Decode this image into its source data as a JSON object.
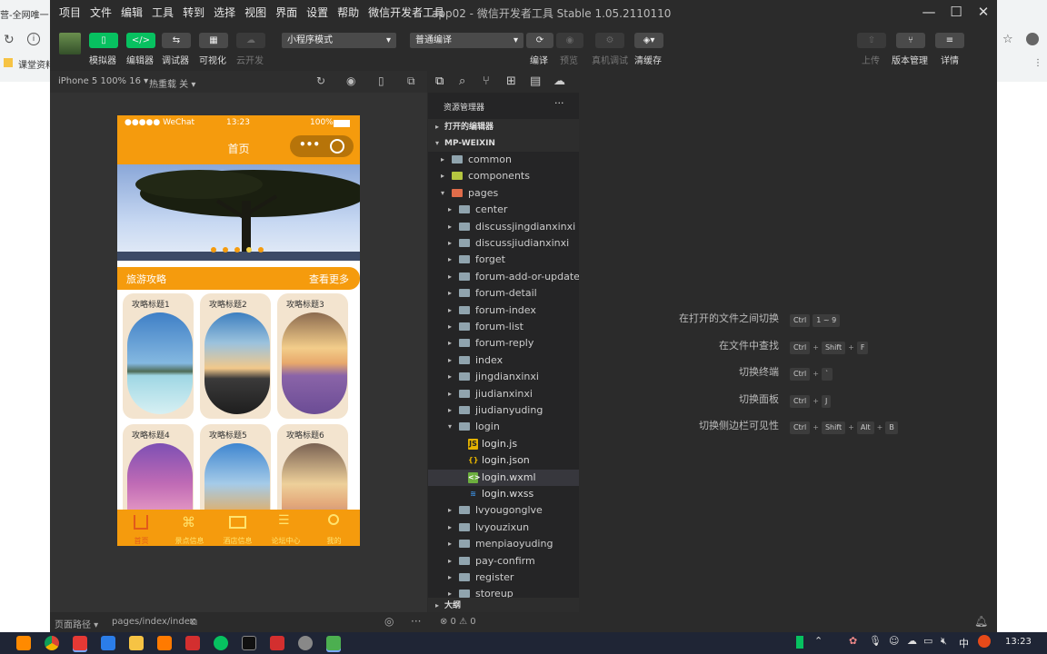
{
  "background_browser": {
    "left_tab_text": "营-全网唯一",
    "bookmark_text": "课堂资料"
  },
  "menubar": {
    "items": [
      "项目",
      "文件",
      "编辑",
      "工具",
      "转到",
      "选择",
      "视图",
      "界面",
      "设置",
      "帮助",
      "微信开发者工具"
    ],
    "window_title": "app02 - 微信开发者工具 Stable 1.05.2110110"
  },
  "toolbar": {
    "simulator_label": "模拟器",
    "editor_label": "编辑器",
    "debugger_label": "调试器",
    "visual_label": "可视化",
    "cloud_label": "云开发",
    "mode_select": "小程序模式",
    "compile_select": "普通编译",
    "compile_label": "编译",
    "preview_label": "预览",
    "remote_debug_label": "真机调试",
    "clear_cache_label": "清缓存",
    "upload_label": "上传",
    "version_label": "版本管理",
    "details_label": "详情"
  },
  "simulator": {
    "device": "iPhone 5 100% 16",
    "hot_reload": "热重载 关",
    "status_carrier": "●●●●● WeChat",
    "status_time": "13:23",
    "status_battery": "100%",
    "nav_title": "首页",
    "section_title": "旅游攻略",
    "section_more": "查看更多",
    "cards": [
      {
        "title": "攻略标题1"
      },
      {
        "title": "攻略标题2"
      },
      {
        "title": "攻略标题3"
      },
      {
        "title": "攻略标题4"
      },
      {
        "title": "攻略标题5"
      },
      {
        "title": "攻略标题6"
      }
    ],
    "tabs": [
      "首页",
      "景点信息",
      "酒店信息",
      "论坛中心",
      "我的"
    ]
  },
  "explorer": {
    "title": "资源管理器",
    "open_editors": "打开的编辑器",
    "project": "MP-WEIXIN",
    "outline": "大纲",
    "tree": [
      {
        "name": "common",
        "type": "folder",
        "depth": 1
      },
      {
        "name": "components",
        "type": "folder",
        "depth": 1
      },
      {
        "name": "pages",
        "type": "folder",
        "depth": 1,
        "open": true
      },
      {
        "name": "center",
        "type": "folder",
        "depth": 2
      },
      {
        "name": "discussjingdianxinxi",
        "type": "folder",
        "depth": 2
      },
      {
        "name": "discussjiudianxinxi",
        "type": "folder",
        "depth": 2
      },
      {
        "name": "forget",
        "type": "folder",
        "depth": 2
      },
      {
        "name": "forum-add-or-update",
        "type": "folder",
        "depth": 2
      },
      {
        "name": "forum-detail",
        "type": "folder",
        "depth": 2
      },
      {
        "name": "forum-index",
        "type": "folder",
        "depth": 2
      },
      {
        "name": "forum-list",
        "type": "folder",
        "depth": 2
      },
      {
        "name": "forum-reply",
        "type": "folder",
        "depth": 2
      },
      {
        "name": "index",
        "type": "folder",
        "depth": 2
      },
      {
        "name": "jingdianxinxi",
        "type": "folder",
        "depth": 2
      },
      {
        "name": "jiudianxinxi",
        "type": "folder",
        "depth": 2
      },
      {
        "name": "jiudianyuding",
        "type": "folder",
        "depth": 2
      },
      {
        "name": "login",
        "type": "folder",
        "depth": 2,
        "open": true
      },
      {
        "name": "login.js",
        "type": "js",
        "depth": 3
      },
      {
        "name": "login.json",
        "type": "json",
        "depth": 3
      },
      {
        "name": "login.wxml",
        "type": "wxml",
        "depth": 3,
        "selected": true
      },
      {
        "name": "login.wxss",
        "type": "wxss",
        "depth": 3
      },
      {
        "name": "lvyougonglve",
        "type": "folder",
        "depth": 2
      },
      {
        "name": "lvyouzixun",
        "type": "folder",
        "depth": 2
      },
      {
        "name": "menpiaoyuding",
        "type": "folder",
        "depth": 2
      },
      {
        "name": "pay-confirm",
        "type": "folder",
        "depth": 2
      },
      {
        "name": "register",
        "type": "folder",
        "depth": 2
      },
      {
        "name": "storeup",
        "type": "folder",
        "depth": 2
      }
    ]
  },
  "editor": {
    "shortcuts": [
      {
        "label": "在打开的文件之间切换",
        "keys": [
          "Ctrl",
          "1 ~ 9"
        ]
      },
      {
        "label": "在文件中查找",
        "keys": [
          "Ctrl",
          "+",
          "Shift",
          "+",
          "F"
        ]
      },
      {
        "label": "切换终端",
        "keys": [
          "Ctrl",
          "+",
          "`"
        ]
      },
      {
        "label": "切换面板",
        "keys": [
          "Ctrl",
          "+",
          "J"
        ]
      },
      {
        "label": "切换侧边栏可见性",
        "keys": [
          "Ctrl",
          "+",
          "Shift",
          "+",
          "Alt",
          "+",
          "B"
        ]
      }
    ]
  },
  "statusbar": {
    "page_path_label": "页面路径",
    "page_path": "pages/index/index",
    "problems": "⊗ 0 ⚠ 0"
  },
  "taskbar": {
    "time": "13:23",
    "ime": "中"
  },
  "colors": {
    "accent_orange": "#f59b0d",
    "wechat_green": "#07c160",
    "tab_label_yellow": "#ffe36e",
    "dark_bg": "#2b2b2b"
  }
}
